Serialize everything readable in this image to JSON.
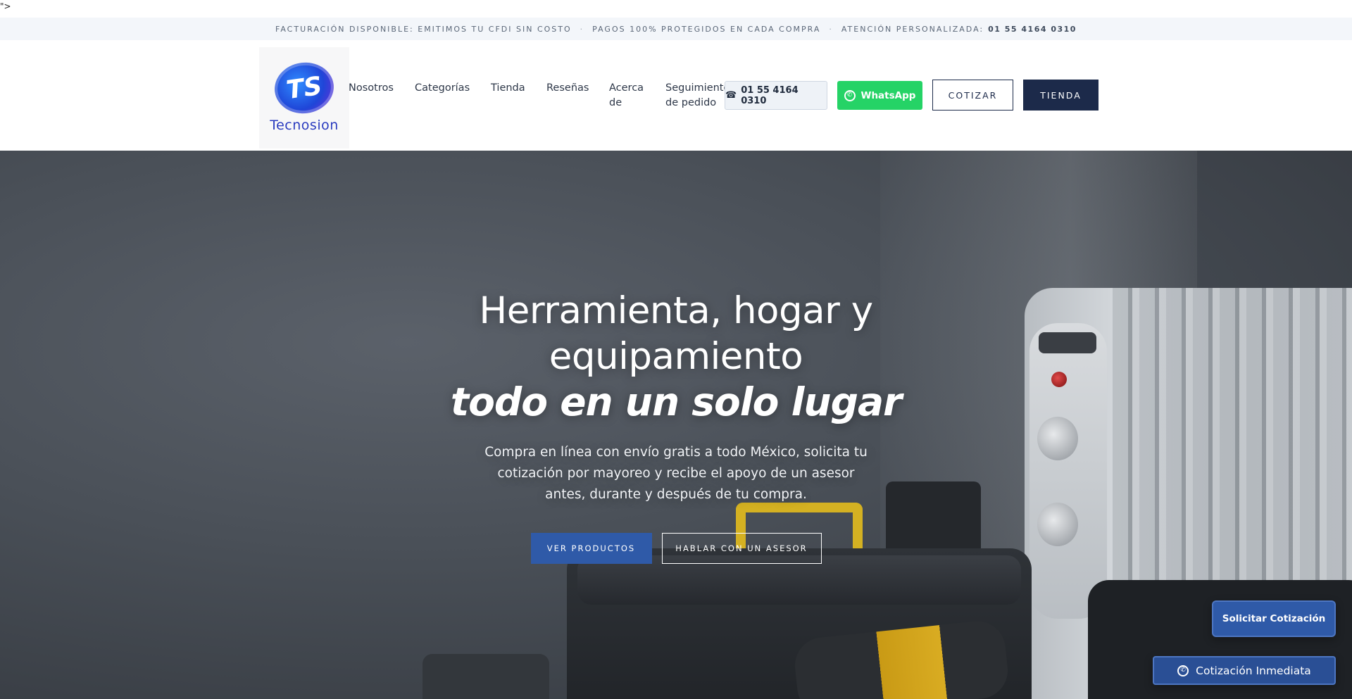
{
  "stray_text": "\">",
  "topbar": {
    "item1": "FACTURACIÓN DISPONIBLE: EMITIMOS TU CFDI SIN COSTO",
    "separator": "·",
    "item2": "PAGOS 100% PROTEGIDOS EN CADA COMPRA",
    "item3_label": "ATENCIÓN PERSONALIZADA:",
    "item3_phone": "01 55 4164 0310"
  },
  "header": {
    "logo": {
      "mark": "TS",
      "text": "Tecnosion"
    },
    "nav": {
      "nosotros": "Nosotros",
      "categorias": "Categorías",
      "tienda": "Tienda",
      "resenas": "Reseñas",
      "acerca_line1": "Acerca",
      "acerca_line2": "de",
      "seguimiento_line1": "Seguimiento",
      "seguimiento_line2": "de pedido"
    },
    "phone_button": {
      "icon": "phone-icon",
      "glyph": "☎",
      "label": "01 55 4164 0310"
    },
    "whatsapp_button": {
      "icon": "whatsapp-icon",
      "label": "WhatsApp"
    },
    "cotizar_button": "COTIZAR",
    "tienda_button": "TIENDA"
  },
  "hero": {
    "title_line1": "Herramienta, hogar y",
    "title_line2": "equipamiento",
    "title_emphasis": "todo en un solo lugar",
    "subtitle": "Compra en línea con envío gratis a todo México, solicita tu cotización por mayoreo y recibe el apoyo de un asesor antes, durante y después de tu compra.",
    "primary_button": "VER PRODUCTOS",
    "secondary_button": "HABLAR CON UN ASESOR"
  },
  "floating": {
    "quote_button": "Solicitar Cotización",
    "instant_button": "Cotización Inmediata",
    "instant_icon": "whatsapp-icon"
  },
  "colors": {
    "navy": "#1c2a4a",
    "whatsapp_green": "#25d366",
    "primary_blue": "#2f5aa8",
    "topbar_bg": "#f3f6fa"
  }
}
